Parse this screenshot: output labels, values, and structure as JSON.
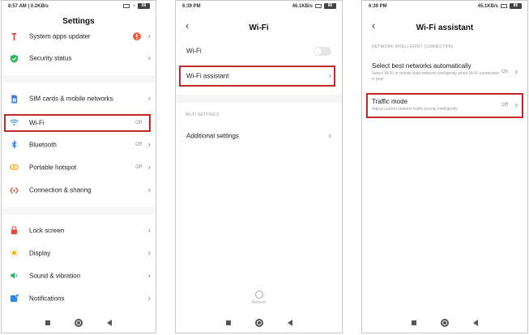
{
  "screen1": {
    "status_time": "8:57 AM | 0.2KB/s",
    "status_right": "58",
    "title": "Settings",
    "items": [
      {
        "label": "System apps updater",
        "value": "",
        "icon_color": "#e24a3b",
        "icon": "phone-arrow-icon"
      },
      {
        "label": "Security status",
        "value": "",
        "icon_color": "#2eb85c",
        "icon": "shield-icon"
      },
      {
        "label": "SIM cards & mobile networks",
        "value": "",
        "icon_color": "#3f7fd8",
        "icon": "sim-icon"
      },
      {
        "label": "Wi-Fi",
        "value": "Off",
        "icon_color": "#2f86e5",
        "icon": "wifi-icon"
      },
      {
        "label": "Bluetooth",
        "value": "Off",
        "icon_color": "#2f86e5",
        "icon": "bluetooth-icon"
      },
      {
        "label": "Portable hotspot",
        "value": "Off",
        "icon_color": "#f2a900",
        "icon": "hotspot-icon"
      },
      {
        "label": "Connection & sharing",
        "value": "",
        "icon_color": "#e2493b",
        "icon": "connection-icon"
      },
      {
        "label": "Lock screen",
        "value": "",
        "icon_color": "#e24a3b",
        "icon": "lock-icon"
      },
      {
        "label": "Display",
        "value": "",
        "icon_color": "#f2b400",
        "icon": "sun-icon"
      },
      {
        "label": "Sound & vibration",
        "value": "",
        "icon_color": "#2eb85c",
        "icon": "speaker-icon"
      },
      {
        "label": "Notifications",
        "value": "",
        "icon_color": "#2f86e5",
        "icon": "notification-icon"
      }
    ]
  },
  "screen2": {
    "status_time": "6:39 PM",
    "status_right": "46.1KB/s",
    "battery": "86",
    "title": "Wi-Fi",
    "wifi_label": "Wi-Fi",
    "assistant_label": "Wi-Fi assistant",
    "section": "WI-FI SETTINGS",
    "additional_label": "Additional settings",
    "refresh_label": "Refresh"
  },
  "screen3": {
    "status_time": "6:39 PM",
    "status_right": "45.1KB/s",
    "battery": "86",
    "title": "Wi-Fi assistant",
    "section": "NETWORK INTELLIGENT CONNECTION",
    "best_title": "Select best networks automatically",
    "best_sub": "Select Wi-Fi or mobile data network intelligently when Wi-Fi connection is poor",
    "best_value": "On",
    "traffic_title": "Traffic mode",
    "traffic_sub": "Adjust current network traffic priority intelligently",
    "traffic_value": "Off"
  },
  "colors": {
    "highlight": "#c62828"
  }
}
